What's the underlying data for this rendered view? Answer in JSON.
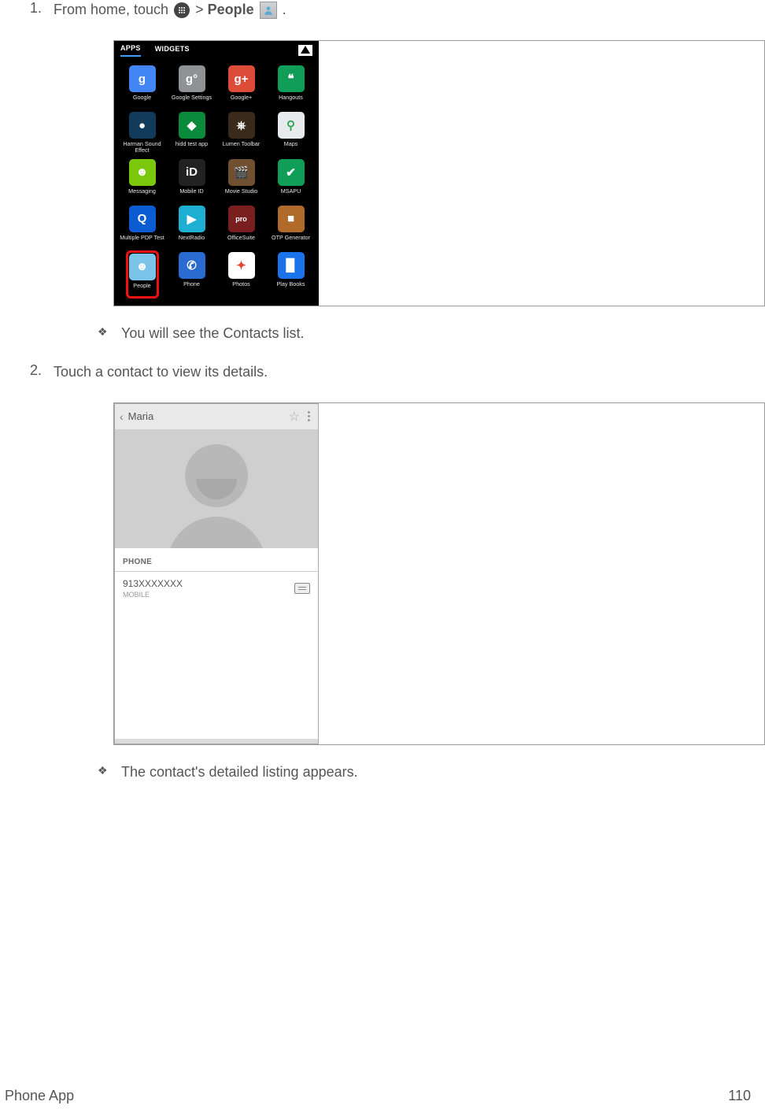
{
  "step1": {
    "num": "1.",
    "text_before": "From home, touch ",
    "text_mid": " > ",
    "text_bold": "People",
    "text_after": " ."
  },
  "drawer": {
    "tabs": {
      "apps": "APPS",
      "widgets": "WIDGETS"
    },
    "apps": [
      {
        "label": "Google",
        "letter": "g",
        "bg": "#4285f4"
      },
      {
        "label": "Google Settings",
        "letter": "g°",
        "bg": "#8f9396"
      },
      {
        "label": "Google+",
        "letter": "g+",
        "bg": "#dd4b39"
      },
      {
        "label": "Hangouts",
        "letter": "❝",
        "bg": "#0f9d58"
      },
      {
        "label": "Harman Sound Effect",
        "letter": "●",
        "bg": "#123a5a"
      },
      {
        "label": "hidd test app",
        "letter": "◆",
        "bg": "#0a8a3a"
      },
      {
        "label": "Lumen Toolbar",
        "letter": "⎈",
        "bg": "#3a2a1a"
      },
      {
        "label": "Maps",
        "letter": "⚲",
        "bg": "#e8eaed",
        "fg": "#34a853"
      },
      {
        "label": "Messaging",
        "letter": "☻",
        "bg": "#7ac70c"
      },
      {
        "label": "Mobile ID",
        "letter": "iD",
        "bg": "#222",
        "fg": "#fff"
      },
      {
        "label": "Movie Studio",
        "letter": "🎬",
        "bg": "#705030"
      },
      {
        "label": "MSAPU",
        "letter": "✔",
        "bg": "#0f9d58"
      },
      {
        "label": "Multiple PDP Test",
        "letter": "Q",
        "bg": "#0b5bd3"
      },
      {
        "label": "NextRadio",
        "letter": "▶",
        "bg": "#1db0d3"
      },
      {
        "label": "OfficeSuite",
        "letter": "pro",
        "bg": "#7a1f1f",
        "small": "1"
      },
      {
        "label": "OTP Generator",
        "letter": "■",
        "bg": "#b06a2a"
      },
      {
        "label": "People",
        "letter": "☻",
        "bg": "#79c4e8",
        "hl": "1"
      },
      {
        "label": "Phone",
        "letter": "✆",
        "bg": "#2a6bd1"
      },
      {
        "label": "Photos",
        "letter": "✦",
        "bg": "#ffffff",
        "fg": "#ea4335"
      },
      {
        "label": "Play Books",
        "letter": "▉",
        "bg": "#1a73e8"
      }
    ]
  },
  "bullet1": "You will see the Contacts list.",
  "step2": {
    "num": "2.",
    "text": "Touch a contact to view its details."
  },
  "contact": {
    "name": "Maria",
    "section": "PHONE",
    "number": "913XXXXXXX",
    "type": "MOBILE"
  },
  "bullet2": "The contact's detailed listing appears.",
  "footer": {
    "left": "Phone App",
    "right": "110"
  }
}
